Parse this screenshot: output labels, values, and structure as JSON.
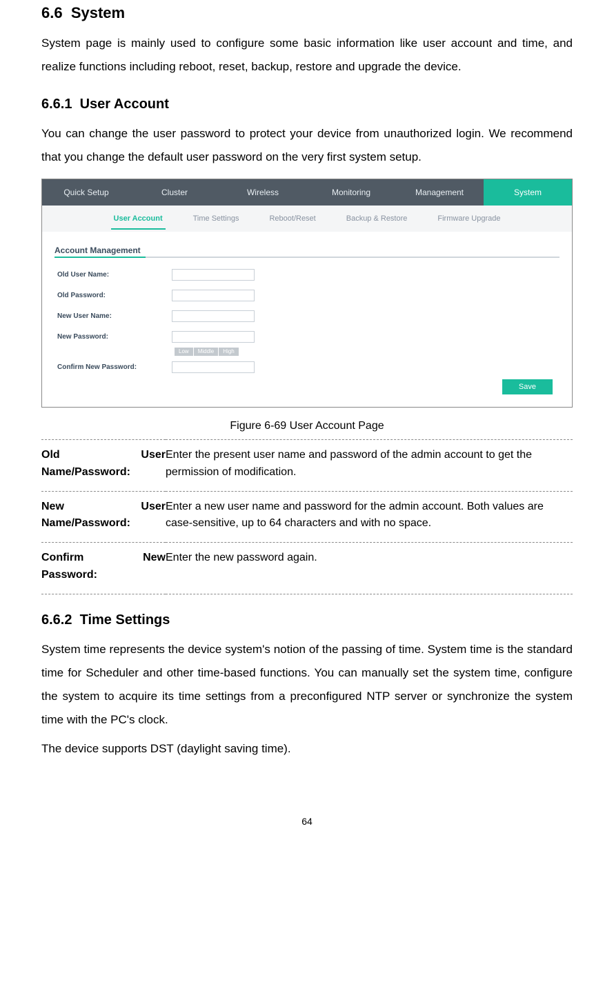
{
  "section_number": "6.6",
  "section_title": "System",
  "section_intro": "System page is mainly used to configure some basic information like user account and time, and realize functions including reboot, reset, backup, restore and upgrade the device.",
  "sub1_number": "6.6.1",
  "sub1_title": "User Account",
  "sub1_intro": "You can change the user password to protect your device from unauthorized login. We recommend that you change the default user password on the very first system setup.",
  "mainnav": {
    "items": [
      {
        "label": "Quick Setup"
      },
      {
        "label": "Cluster"
      },
      {
        "label": "Wireless"
      },
      {
        "label": "Monitoring"
      },
      {
        "label": "Management"
      },
      {
        "label": "System"
      }
    ]
  },
  "subnav": {
    "items": [
      {
        "label": "User Account"
      },
      {
        "label": "Time Settings"
      },
      {
        "label": "Reboot/Reset"
      },
      {
        "label": "Backup & Restore"
      },
      {
        "label": "Firmware Upgrade"
      }
    ]
  },
  "form": {
    "section_label": "Account Management",
    "fields": {
      "old_user": "Old User Name:",
      "old_pw": "Old Password:",
      "new_user": "New User Name:",
      "new_pw": "New Password:",
      "confirm_pw": "Confirm New Password:"
    },
    "strength": {
      "low": "Low",
      "middle": "Middle",
      "high": "High"
    },
    "save_label": "Save"
  },
  "figcaption": "Figure 6-69 User Account Page",
  "defs": [
    {
      "term_a": "Old",
      "term_b": "User",
      "term_line2": "Name/Password:",
      "desc": "Enter the present user name and password of the admin account to get the permission of modification."
    },
    {
      "term_a": "New",
      "term_b": "User",
      "term_line2": "Name/Password:",
      "desc": "Enter a new user name and password for the admin account. Both values are case-sensitive, up to 64 characters and with no space."
    },
    {
      "term_a": "Confirm",
      "term_b": "New",
      "term_line2": "Password:",
      "desc": "Enter the new password again."
    }
  ],
  "sub2_number": "6.6.2",
  "sub2_title": "Time Settings",
  "sub2_p1": "System time represents the device system's notion of the passing of time. System time is the standard time for Scheduler and other time-based functions. You can manually set the system time, configure the system to acquire its time settings from a preconfigured NTP server or synchronize the system time with the PC's clock.",
  "sub2_p2": "The device supports DST (daylight saving time).",
  "page_number": "64"
}
